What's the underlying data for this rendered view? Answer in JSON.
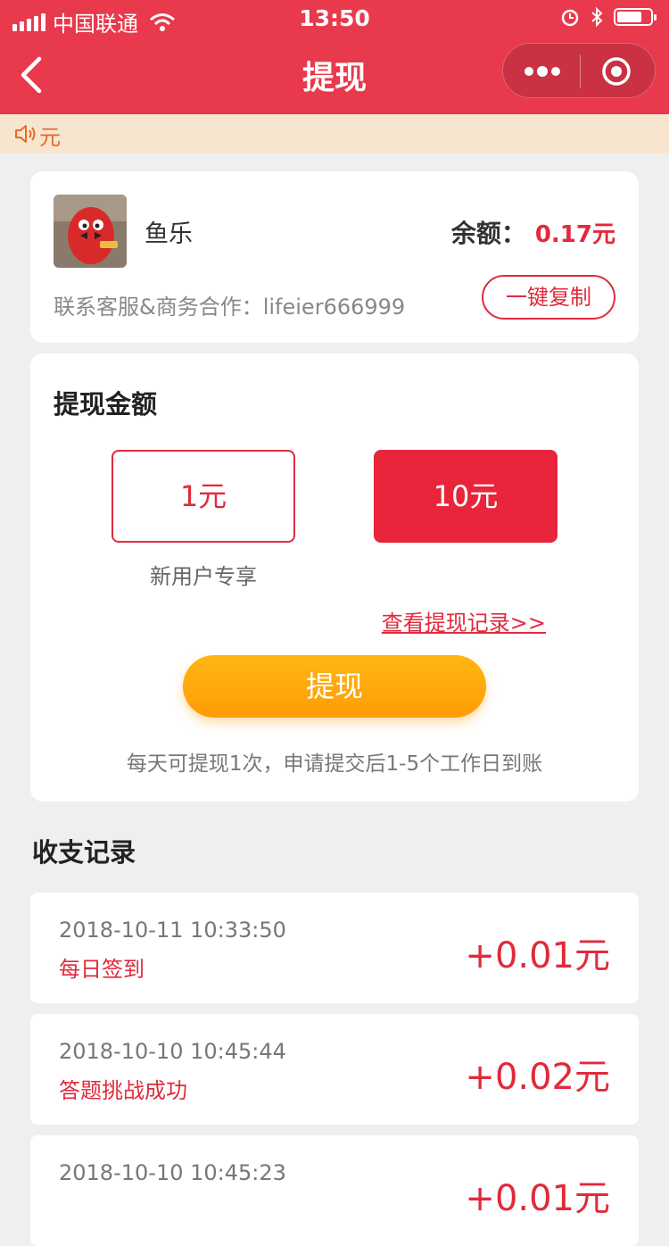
{
  "status_bar": {
    "carrier": "中国联通",
    "time": "13:50",
    "battery_level": 0.75
  },
  "nav": {
    "title": "提现",
    "icons": [
      "back-icon",
      "more-dots-icon",
      "close-target-icon"
    ]
  },
  "notice": {
    "text": "元",
    "icon": "speaker-icon"
  },
  "profile": {
    "name": "鱼乐",
    "balance_label": "余额：",
    "balance_value": "0.17元",
    "contact": "联系客服&商务合作：lifeier666999",
    "copy_button": "一键复制"
  },
  "withdraw": {
    "title": "提现金额",
    "options": [
      {
        "label": "1元",
        "selected": false
      },
      {
        "label": "10元",
        "selected": true
      }
    ],
    "new_user_note": "新用户专享",
    "records_link": "查看提现记录>>",
    "submit": "提现",
    "note": "每天可提现1次，申请提交后1-5个工作日到账"
  },
  "records": {
    "title": "收支记录",
    "items": [
      {
        "time": "2018-10-11 10:33:50",
        "desc": "每日签到",
        "amount": "+0.01元"
      },
      {
        "time": "2018-10-10 10:45:44",
        "desc": "答题挑战成功",
        "amount": "+0.02元"
      },
      {
        "time": "2018-10-10 10:45:23",
        "desc": "",
        "amount": "+0.01元"
      }
    ]
  },
  "colors": {
    "primary": "#e8394d",
    "accent_red": "#e12a3c",
    "button_orange": "#ffa60c",
    "notice_bg": "#f8e5cf"
  }
}
